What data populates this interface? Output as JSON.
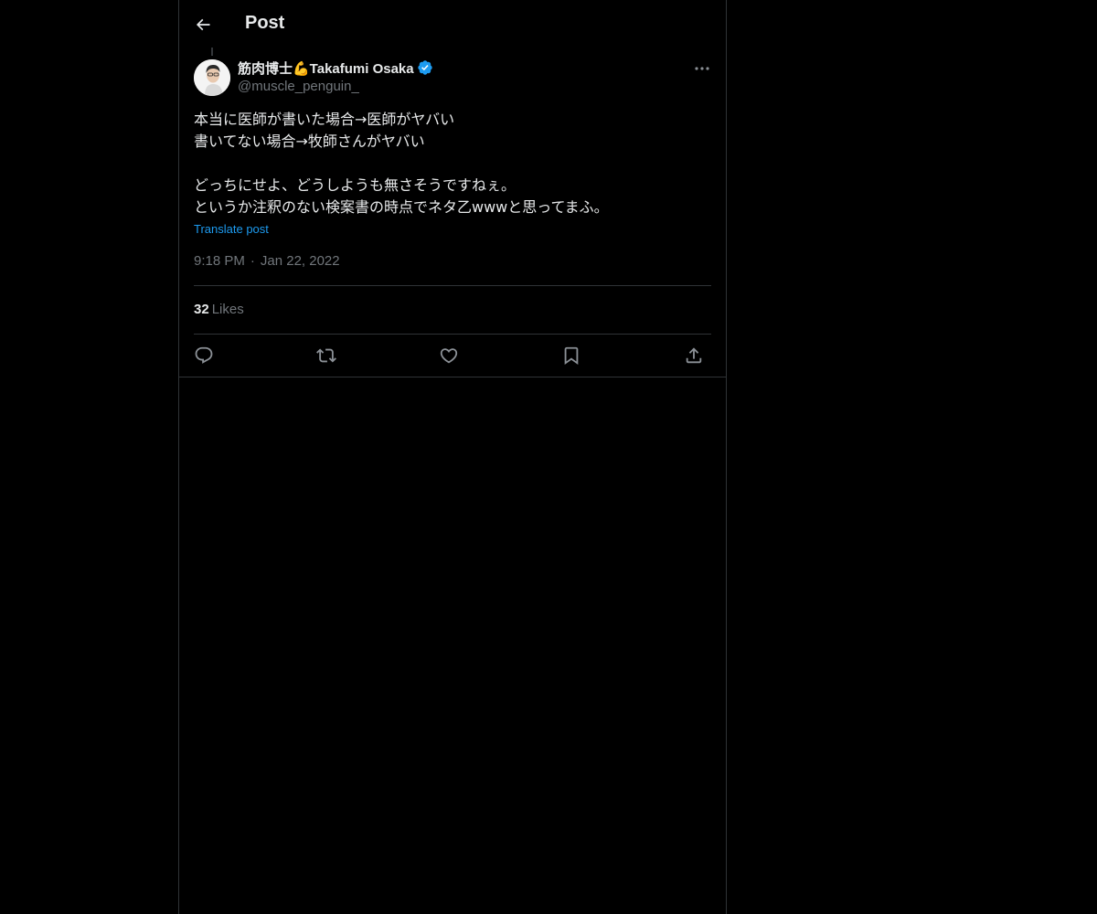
{
  "header": {
    "title": "Post",
    "back_icon": "arrow-left-icon"
  },
  "post": {
    "author": {
      "display_name": "筋肉博士💪Takafumi Osaka",
      "handle": "@muscle_penguin_",
      "verified": true,
      "verified_color": "#1d9bf0"
    },
    "text_lines": [
      "本当に医師が書いた場合→医師がヤバい",
      "書いてない場合→牧師さんがヤバい",
      "",
      "どっちにせよ、どうしようも無さそうですねぇ。",
      "というか注釈のない検案書の時点でネタ乙wwwと思ってまふ。"
    ],
    "translate_label": "Translate post",
    "time": "9:18 PM",
    "separator": "·",
    "date": "Jan 22, 2022",
    "likes": {
      "count": "32",
      "label": "Likes"
    }
  },
  "actions": [
    {
      "name": "reply",
      "icon": "reply-icon"
    },
    {
      "name": "repost",
      "icon": "repost-icon"
    },
    {
      "name": "like",
      "icon": "heart-icon"
    },
    {
      "name": "bookmark",
      "icon": "bookmark-icon"
    },
    {
      "name": "share",
      "icon": "share-icon"
    }
  ],
  "colors": {
    "background": "#000000",
    "text": "#e7e9ea",
    "secondary": "#71767b",
    "accent": "#1d9bf0",
    "border": "#2f3336"
  }
}
